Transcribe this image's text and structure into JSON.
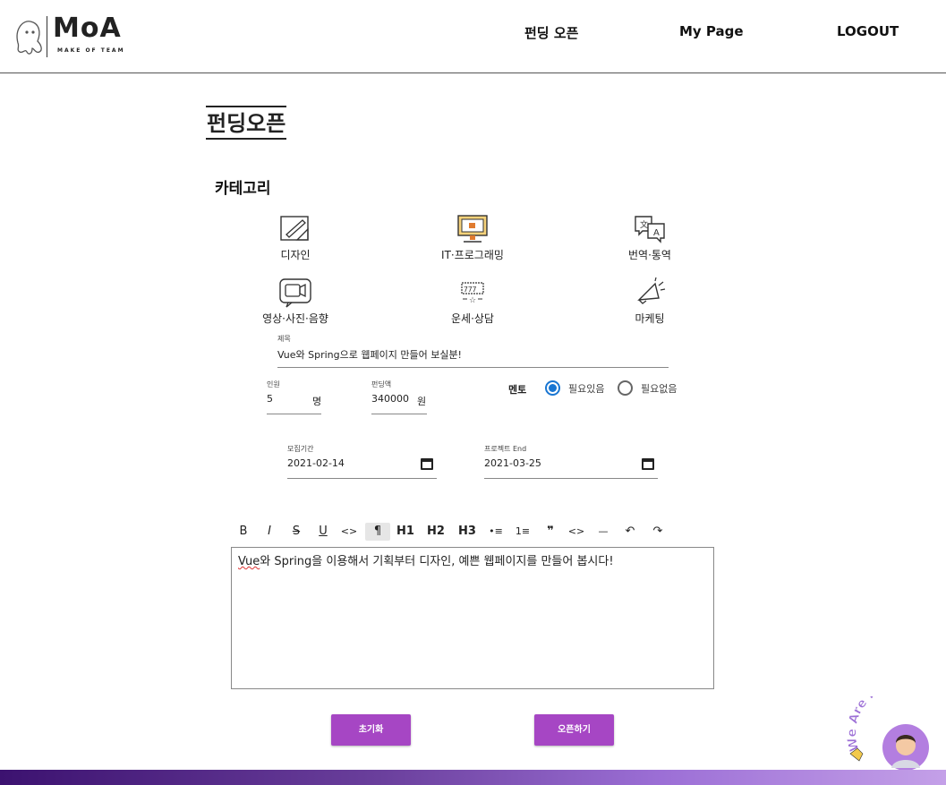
{
  "header": {
    "logo_word": "MoA",
    "logo_tag": "MAKE OF TEAM",
    "nav": [
      "펀딩 오픈",
      "My Page",
      "LOGOUT"
    ]
  },
  "page": {
    "title": "펀딩오픈",
    "category_label": "카테고리"
  },
  "categories": [
    {
      "label": "디자인",
      "icon": "design-icon"
    },
    {
      "label": "IT·프로그래밍",
      "icon": "computer-icon"
    },
    {
      "label": "번역·통역",
      "icon": "translate-icon"
    },
    {
      "label": "영상·사진·음향",
      "icon": "video-icon"
    },
    {
      "label": "운세·상담",
      "icon": "fortune-icon"
    },
    {
      "label": "마케팅",
      "icon": "megaphone-icon"
    }
  ],
  "form": {
    "title_label": "제목",
    "title_value": "Vue와 Spring으로 웹페이지 만들어 보실분!",
    "people_label": "인원",
    "people_value": "5",
    "people_unit": "명",
    "amount_label": "펀딩액",
    "amount_value": "340000",
    "amount_unit": "원",
    "mentor_label": "멘토",
    "mentor_options": [
      "필요있음",
      "필요없음"
    ],
    "mentor_selected": "필요있음",
    "recruit_label": "모집기간",
    "recruit_value": "2021-02-14",
    "project_end_label": "프로젝트 End",
    "project_end_value": "2021-03-25"
  },
  "toolbar": {
    "items": [
      "B",
      "I",
      "S",
      "U",
      "<>",
      "¶",
      "H1",
      "H2",
      "H3",
      "•≡",
      "1≡",
      "❞",
      "<>",
      "—",
      "↶",
      "↷"
    ],
    "active": "¶"
  },
  "editor": {
    "word_vue": "Vue",
    "rest": "와 Spring을 이용해서 기획부터 디자인, 예쁜 웹페이지를 만들어 봅시다!"
  },
  "buttons": {
    "reset": "초기화",
    "open": "오픈하기"
  },
  "badge": {
    "text": "We Are Here!"
  },
  "colors": {
    "accent": "#a646c4",
    "radio": "#1976d2",
    "footer_start": "#3c1270",
    "footer_end": "#c4a0e8"
  }
}
